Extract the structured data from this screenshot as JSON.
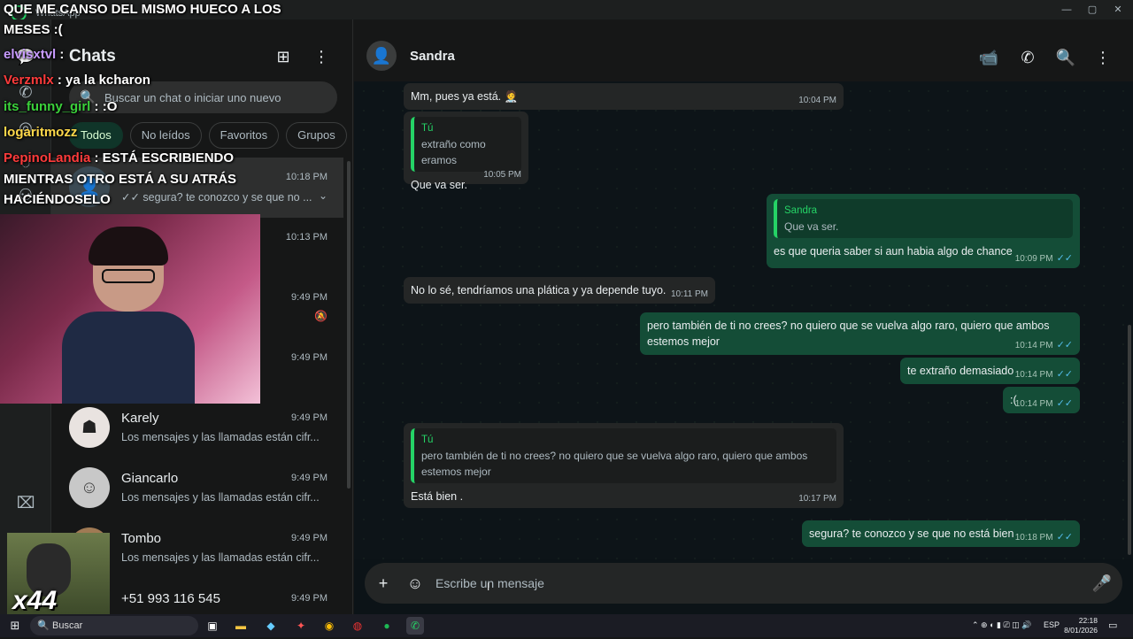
{
  "window": {
    "title": "WhatsApp",
    "minimize_icon": "minimize-icon",
    "maximize_icon": "maximize-icon",
    "close_icon": "close-icon"
  },
  "sidebar": {
    "title": "Chats",
    "new_chat_icon": "new-chat-icon",
    "menu_icon": "kebab-menu-icon",
    "search_placeholder": "Buscar un chat o iniciar uno nuevo",
    "filters": [
      {
        "label": "Todos",
        "active": true
      },
      {
        "label": "No leídos",
        "active": false
      },
      {
        "label": "Favoritos",
        "active": false
      },
      {
        "label": "Grupos",
        "active": false
      }
    ],
    "chats": [
      {
        "name": "",
        "time": "10:18 PM",
        "preview": "✓✓ segura? te conozco y se que no ...",
        "selected": true
      },
      {
        "name": "",
        "time": "10:13 PM",
        "preview": ""
      },
      {
        "name": "",
        "time": "9:49 PM",
        "preview": "s están ..."
      },
      {
        "name": "",
        "time": "9:49 PM",
        "preview": "están cifr..."
      },
      {
        "name": "Karely",
        "time": "9:49 PM",
        "preview": "Los mensajes y las llamadas están cifr..."
      },
      {
        "name": "Giancarlo",
        "time": "9:49 PM",
        "preview": "Los mensajes y las llamadas están cifr..."
      },
      {
        "name": "Tombo",
        "time": "9:49 PM",
        "preview": "Los mensajes y las llamadas están cifr..."
      },
      {
        "name": "+51 993 116 545",
        "time": "9:49 PM",
        "preview": ""
      }
    ]
  },
  "chat": {
    "contact_name": "Sandra",
    "header_icons": [
      "video-call-icon",
      "phone-icon",
      "search-icon",
      "kebab-menu-icon"
    ],
    "messages": [
      {
        "dir": "in",
        "text": "Mm, pues ya está. 🧑‍⚕️",
        "time": "10:04 PM"
      },
      {
        "dir": "in",
        "quote_name": "Tú",
        "quote_text": "extraño como eramos",
        "text": "Que va ser.",
        "time": "10:05 PM"
      },
      {
        "dir": "out",
        "quote_name": "Sandra",
        "quote_text": "Que va ser.",
        "text": "es que queria saber si aun habia algo de chance",
        "time": "10:09 PM",
        "ticks": "✓✓"
      },
      {
        "dir": "in",
        "text": "No lo sé, tendríamos una plática y ya depende tuyo.",
        "time": "10:11 PM"
      },
      {
        "dir": "out",
        "text": "pero también de ti no crees? no quiero que se vuelva algo raro, quiero que ambos estemos mejor",
        "time": "10:14 PM",
        "ticks": "✓✓"
      },
      {
        "dir": "out",
        "text": "te extraño demasiado",
        "time": "10:14 PM",
        "ticks": "✓✓"
      },
      {
        "dir": "out",
        "text": ":(",
        "time": "10:14 PM",
        "ticks": "✓✓"
      },
      {
        "dir": "in",
        "quote_name": "Tú",
        "quote_text": "pero también de ti no crees? no quiero que se vuelva algo raro, quiero que ambos estemos mejor",
        "text": "Está bien .",
        "time": "10:17 PM"
      },
      {
        "dir": "out",
        "text": "segura? te conozco y se que no está bien",
        "time": "10:18 PM",
        "ticks": "✓✓"
      }
    ],
    "composer_placeholder": "Escribe un mensaje"
  },
  "stream_overlay": {
    "lines": [
      {
        "user": "",
        "text": "QUE ME CANSO DEL MISMO HUECO A LOS",
        "color": "#ffffff"
      },
      {
        "user": "",
        "text": "MESES :(",
        "color": "#ffffff"
      },
      {
        "user": "elvisxtvl",
        "text": ":",
        "color": "#c89bff"
      },
      {
        "user": "Verzmlx",
        "text": ": ya la kcharon",
        "color": "#ff3b3b"
      },
      {
        "user": "its_funny_girl",
        "text": ": :O",
        "color": "#3bd13b"
      },
      {
        "user": "logaritmozz",
        "text": "",
        "color": "#ffd84a"
      },
      {
        "user": "PepinoLandia",
        "text": ": ESTÁ ESCRIBIENDO",
        "color": "#ff3b3b"
      },
      {
        "user": "",
        "text": "MIENTRAS OTRO ESTÁ A SU ATRÁS",
        "color": "#ffffff"
      },
      {
        "user": "",
        "text": "HACIÉNDOSELO",
        "color": "#ffffff"
      }
    ],
    "gif_caption": "x44"
  },
  "taskbar": {
    "search_label": "Buscar",
    "language": "ESP",
    "time": "22:18",
    "date": "8/01/2026"
  },
  "colors": {
    "accent": "#25d366",
    "outgoing_bubble": "#144d37",
    "incoming_bubble": "#242626",
    "read_ticks": "#53bdeb"
  }
}
